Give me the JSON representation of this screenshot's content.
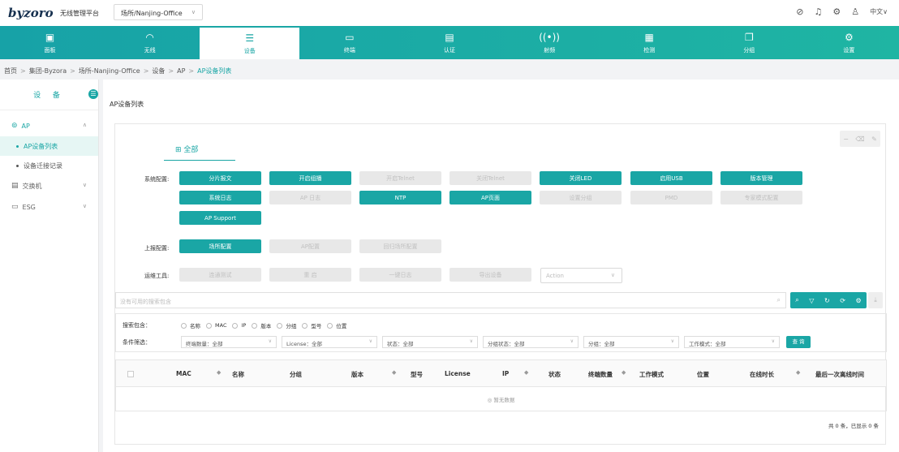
{
  "header": {
    "logo": "byzoro",
    "platform": "无线管理平台",
    "site_select": "场所/Nanjing-Office",
    "lang": "中文"
  },
  "nav": [
    {
      "label": "面板",
      "icon": "dashboard-icon"
    },
    {
      "label": "无线",
      "icon": "wifi-icon"
    },
    {
      "label": "设备",
      "icon": "device-icon",
      "active": true
    },
    {
      "label": "终端",
      "icon": "terminal-icon"
    },
    {
      "label": "认证",
      "icon": "auth-icon"
    },
    {
      "label": "射频",
      "icon": "rf-icon"
    },
    {
      "label": "检测",
      "icon": "detect-icon"
    },
    {
      "label": "分组",
      "icon": "group-icon"
    },
    {
      "label": "设置",
      "icon": "settings-icon"
    }
  ],
  "breadcrumb": [
    "首页",
    "集团-Byzora",
    "场所-Nanjing-Office",
    "设备",
    "AP",
    "AP设备列表"
  ],
  "sidebar": {
    "title": "设 备",
    "groups": [
      {
        "label": "AP"
      },
      {
        "label": "交换机"
      },
      {
        "label": "ESG"
      }
    ],
    "sub_items": [
      "AP设备列表",
      "设备迁接记录"
    ]
  },
  "page_title": "AP设备列表",
  "tab_all": "全部",
  "rows": {
    "system": "系统配置:",
    "upper": "上报配置:",
    "ops": "运维工具:"
  },
  "system_buttons": [
    {
      "label": "分片报文",
      "enabled": true
    },
    {
      "label": "开启组播",
      "enabled": true
    },
    {
      "label": "开启Telnet",
      "enabled": false
    },
    {
      "label": "关闭Telnet",
      "enabled": false
    },
    {
      "label": "关闭LED",
      "enabled": true
    },
    {
      "label": "启用USB",
      "enabled": true
    },
    {
      "label": "版本管理",
      "enabled": true
    },
    {
      "label": "系统日志",
      "enabled": true
    },
    {
      "label": "AP 日志",
      "enabled": false
    },
    {
      "label": "NTP",
      "enabled": true
    },
    {
      "label": "AP页面",
      "enabled": true
    },
    {
      "label": "设置分组",
      "enabled": false
    },
    {
      "label": "PMD",
      "enabled": false
    },
    {
      "label": "专家模式配置",
      "enabled": false
    },
    {
      "label": "AP Support",
      "enabled": true
    }
  ],
  "upper_buttons": [
    {
      "label": "场所配置",
      "enabled": true
    },
    {
      "label": "AP配置",
      "enabled": false
    },
    {
      "label": "回归场所配置",
      "enabled": false
    }
  ],
  "ops_buttons": [
    {
      "label": "连通测试",
      "enabled": false
    },
    {
      "label": "重 启",
      "enabled": false
    },
    {
      "label": "一键日志",
      "enabled": false
    },
    {
      "label": "导出设备",
      "enabled": false
    }
  ],
  "action_placeholder": "Action",
  "search_placeholder": "没有可用的搜索包含",
  "filter": {
    "search_label": "搜索包含：",
    "condition_label": "条件筛选：",
    "radios": [
      "名称",
      "MAC",
      "IP",
      "版本",
      "分组",
      "型号",
      "位置"
    ],
    "selects": [
      "终端数量：全部",
      "License：全部",
      "状态：全部",
      "分组状态：全部",
      "分组：全部",
      "工作模式：全部"
    ],
    "query": "查 询"
  },
  "table": {
    "columns": [
      "MAC",
      "名称",
      "分组",
      "版本",
      "型号",
      "License",
      "IP",
      "状态",
      "终端数量",
      "工作模式",
      "位置",
      "在线时长",
      "最后一次离线时间"
    ],
    "empty": "◎ 暂无数据"
  },
  "total": "共 0 条，已显示 0 条"
}
